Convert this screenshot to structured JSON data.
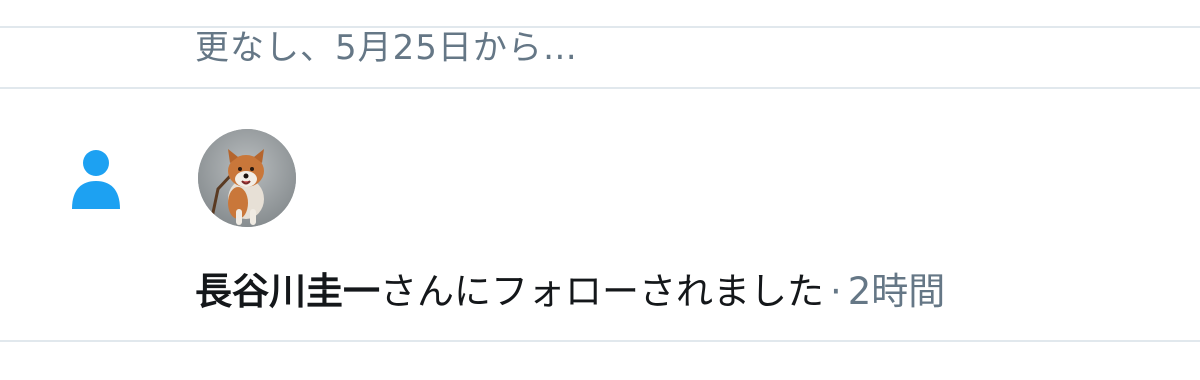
{
  "previous_item": {
    "snippet": "更なし、5月25日から…"
  },
  "notification": {
    "type_icon": "person-icon",
    "avatar_description": "shiba-dog-avatar",
    "follower_name": "長谷川圭一",
    "action_text": "さんにフォローされました",
    "separator": "·",
    "time_ago": "2時間"
  },
  "colors": {
    "accent": "#1da1f2",
    "text_primary": "#14171a",
    "text_secondary": "#657786",
    "divider": "#e1e8ed"
  }
}
